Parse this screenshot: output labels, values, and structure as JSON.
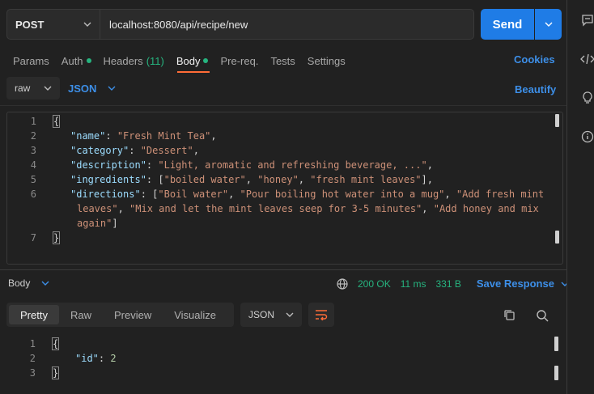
{
  "request": {
    "method": "POST",
    "url": "localhost:8080/api/recipe/new",
    "send_label": "Send"
  },
  "tabs": {
    "params": "Params",
    "auth": "Auth",
    "headers": "Headers",
    "headers_count": "(11)",
    "body": "Body",
    "prereq": "Pre-req.",
    "tests": "Tests",
    "settings": "Settings",
    "cookies": "Cookies"
  },
  "body_options": {
    "mode": "raw",
    "language": "JSON",
    "beautify": "Beautify"
  },
  "request_body": {
    "line_numbers": [
      "1",
      "2",
      "3",
      "4",
      "5",
      "6",
      "7"
    ],
    "open_brace": "{",
    "close_brace": "}",
    "name_key": "\"name\"",
    "name_val": "\"Fresh Mint Tea\"",
    "category_key": "\"category\"",
    "category_val": "\"Dessert\"",
    "description_key": "\"description\"",
    "description_val": "\"Light, aromatic and refreshing beverage, ...\"",
    "ingredients_key": "\"ingredients\"",
    "ingredients_1": "\"boiled water\"",
    "ingredients_2": "\"honey\"",
    "ingredients_3": "\"fresh mint leaves\"",
    "directions_key": "\"directions\"",
    "directions_1": "\"Boil water\"",
    "directions_2": "\"Pour boiling hot water into a mug\"",
    "directions_3a": "\"Add fresh mint",
    "directions_3b": "leaves\"",
    "directions_4": "\"Mix and let the mint leaves seep for 3-5 minutes\"",
    "directions_5a": "\"Add honey and mix",
    "directions_5b": "again\""
  },
  "response": {
    "body_label": "Body",
    "status": "200 OK",
    "time": "11 ms",
    "size": "331 B",
    "save": "Save Response",
    "views": [
      "Pretty",
      "Raw",
      "Preview",
      "Visualize"
    ],
    "format": "JSON",
    "line_numbers": [
      "1",
      "2",
      "3"
    ],
    "open_brace": "{",
    "close_brace": "}",
    "id_key": "\"id\"",
    "id_val": "2"
  },
  "colors": {
    "accent": "#1f7ce6",
    "tab_active": "#ff6c37",
    "success": "#26b47f"
  },
  "icons": [
    "chevron-down-icon",
    "globe-icon",
    "copy-icon",
    "search-icon",
    "wrap-lines-icon",
    "comments-icon",
    "code-icon",
    "bulb-icon",
    "info-icon"
  ]
}
